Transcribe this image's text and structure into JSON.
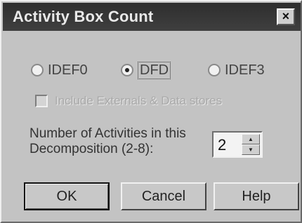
{
  "window": {
    "title": "Activity Box Count",
    "close_glyph": "×"
  },
  "methodology": {
    "options": [
      {
        "label": "IDEF0",
        "selected": false
      },
      {
        "label": "DFD",
        "selected": true
      },
      {
        "label": "IDEF3",
        "selected": false
      }
    ]
  },
  "include_externals": {
    "label": "Include Externals & Data stores",
    "checked": false,
    "enabled": false
  },
  "activities": {
    "label_line1": "Number of Activities in this",
    "label_line2": "Decomposition (2-8):",
    "value": "2"
  },
  "buttons": {
    "ok": "OK",
    "cancel": "Cancel",
    "help": "Help"
  },
  "icons": {
    "close": "close-icon",
    "spin_up": "chevron-up-icon",
    "spin_down": "chevron-down-icon"
  }
}
